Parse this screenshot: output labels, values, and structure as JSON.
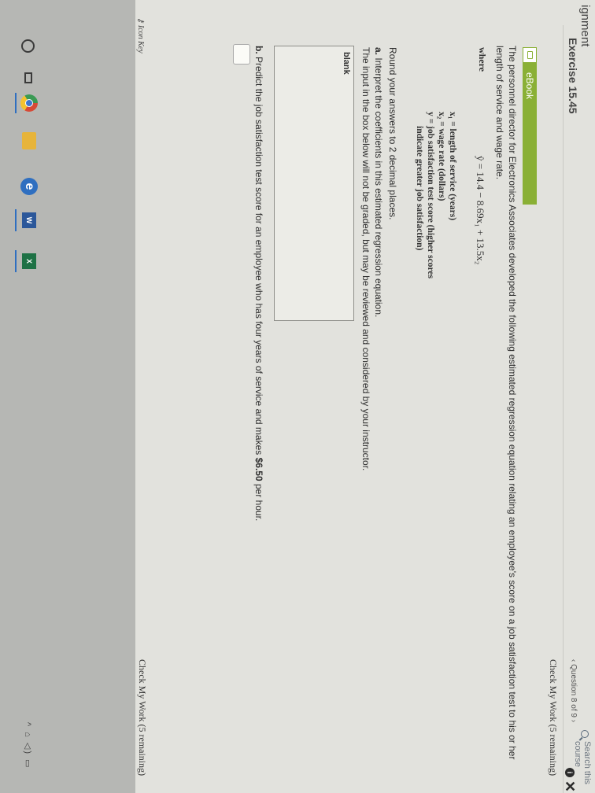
{
  "header": {
    "title": "ignment",
    "search_placeholder": "Search this course",
    "info_glyph": "i",
    "close_glyph": "✕"
  },
  "exercise": {
    "title": "Exercise 15.45",
    "question_nav": "‹ Question 8 of 9 ›"
  },
  "check_my_work_top": "Check My Work (5 remaining)",
  "check_my_work_bottom": "Check My Work (5 remaining)",
  "ebook": {
    "label": "eBook",
    "icon": "book-icon"
  },
  "problem": {
    "intro_line1": "The personnel director for Electronics Associates developed the following estimated regression equation relating an employee's score on a job satisfaction test to his or her",
    "intro_line2": "length of service and wage rate.",
    "equation": "ŷ = 14.4 − 8.69x₁ + 13.5x₂",
    "where_label": "where",
    "definitions": [
      "x₁ = length of service (years)",
      "x₂ = wage rate (dollars)",
      "y = job satisfaction test score (higher scores",
      "indicate greater job satisfaction)"
    ],
    "round_note": "Round your answers to 2 decimal places.",
    "part_a_label": "a.",
    "part_a_text": "Interpret the coefficients in this estimated regression equation.",
    "part_a_note": "The input in the box below will not be graded, but may be reviewed and considered by your instructor.",
    "answer_box_label": "blank",
    "part_b_label": "b.",
    "part_b_text_before": "Predict the job satisfaction test score for an employee who has four years of service and makes ",
    "part_b_amount": "$6.50",
    "part_b_text_after": " per hour.",
    "part_b_value": ""
  },
  "icon_key": "Icon Key",
  "taskbar": {
    "word_label": "W",
    "excel_label": "X",
    "edge_glyph": "e",
    "tray_text": "^ ⌂ ◁) ▭"
  },
  "colors": {
    "ebook_green": "#8ab035",
    "taskbar_bg": "#b6b7b4",
    "page_bg": "#e2e2dd"
  }
}
